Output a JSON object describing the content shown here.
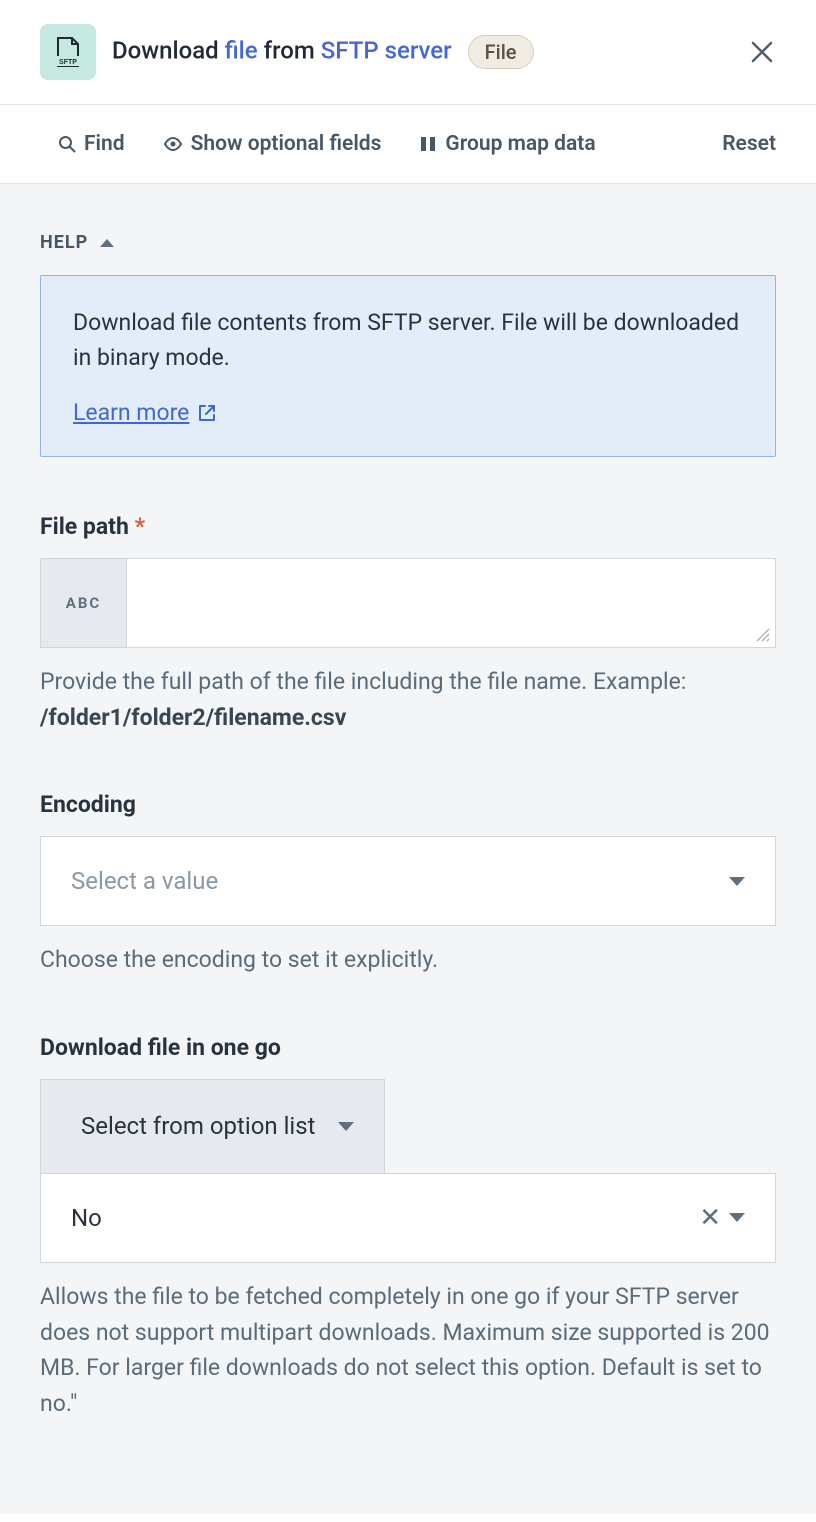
{
  "header": {
    "title_pre": "Download ",
    "title_link1": "file",
    "title_mid": " from ",
    "title_link2": "SFTP server",
    "badge": "File"
  },
  "toolbar": {
    "find": "Find",
    "optional": "Show optional fields",
    "group": "Group map data",
    "reset": "Reset"
  },
  "help": {
    "heading": "HELP",
    "text": "Download file contents from SFTP server. File will be downloaded in binary mode.",
    "learn_more": "Learn more"
  },
  "fields": {
    "file_path": {
      "label": "File path",
      "type_badge": "ABC",
      "value": "",
      "hint_pre": "Provide the full path of the file including the file name. Example: ",
      "hint_bold": "/folder1/folder2/filename.csv"
    },
    "encoding": {
      "label": "Encoding",
      "placeholder": "Select a value",
      "hint": "Choose the encoding to set it explicitly."
    },
    "download_one_go": {
      "label": "Download file in one go",
      "option_tab": "Select from option list",
      "value": "No",
      "hint": "Allows the file to be fetched completely in one go if your SFTP server does not support multipart downloads. Maximum size supported is 200 MB. For larger file downloads do not select this option. Default is set to no.\""
    }
  }
}
